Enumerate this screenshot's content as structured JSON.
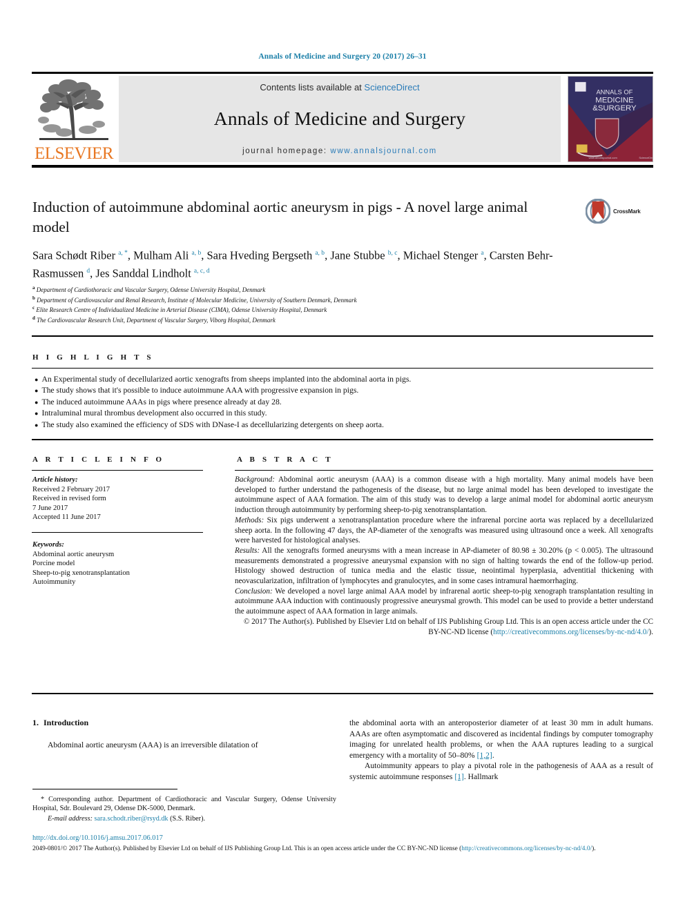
{
  "running_head": "Annals of Medicine and Surgery 20 (2017) 26–31",
  "masthead": {
    "publisher_name": "ELSEVIER",
    "contents_prefix": "Contents lists available at ",
    "contents_link": "ScienceDirect",
    "journal_name": "Annals of Medicine and Surgery",
    "homepage_prefix": "journal homepage: ",
    "homepage_link": "www.annalsjournal.com",
    "cover_title_line1": "ANNALS OF",
    "cover_title_line2": "MEDICINE",
    "cover_title_line3": "&SURGERY"
  },
  "article": {
    "title": "Induction of autoimmune abdominal aortic aneurysm in pigs - A novel large animal model",
    "crossmark_label": "CrossMark",
    "authors_html": "Sara Schødt Riber <sup>a, *</sup>, Mulham Ali <sup>a, b</sup>, Sara Hveding Bergseth <sup>a, b</sup>, Jane Stubbe <sup>b, c</sup>, Michael Stenger <sup>a</sup>, Carsten Behr-Rasmussen <sup>d</sup>, Jes Sanddal Lindholt <sup>a, c, d</sup>",
    "affiliations": [
      {
        "mark": "a",
        "text": "Department of Cardiothoracic and Vascular Surgery, Odense University Hospital, Denmark"
      },
      {
        "mark": "b",
        "text": "Department of Cardiovascular and Renal Research, Institute of Molecular Medicine, University of Southern Denmark, Denmark"
      },
      {
        "mark": "c",
        "text": "Elite Research Centre of Individualized Medicine in Arterial Disease (CIMA), Odense University Hospital, Denmark"
      },
      {
        "mark": "d",
        "text": "The Cardiovascular Research Unit, Department of Vascular Surgery, Viborg Hospital, Denmark"
      }
    ]
  },
  "highlights": {
    "heading": "H I G H L I G H T S",
    "bullet_glyph": "●",
    "items": [
      "An Experimental study of decellularized aortic xenografts from sheeps implanted into the abdominal aorta in pigs.",
      "The study shows that it's possible to induce autoimmune AAA with progressive expansion in pigs.",
      "The induced autoimmune AAAs in pigs where presence already at day 28.",
      "Intraluminal mural thrombus development also occurred in this study.",
      "The study also examined the efficiency of SDS with DNase-I as decellularizing detergents on sheep aorta."
    ]
  },
  "article_info": {
    "heading": "A R T I C L E  I N F O",
    "history_label": "Article history:",
    "history_lines": [
      "Received 2 February 2017",
      "Received in revised form",
      "7 June 2017",
      "Accepted 11 June 2017"
    ],
    "keywords_label": "Keywords:",
    "keywords": [
      "Abdominal aortic aneurysm",
      "Porcine model",
      "Sheep-to-pig xenotransplantation",
      "Autoimmunity"
    ]
  },
  "abstract": {
    "heading": "A B S T R A C T",
    "background_label": "Background:",
    "background_text": " Abdominal aortic aneurysm (AAA) is a common disease with a high mortality. Many animal models have been developed to further understand the pathogenesis of the disease, but no large animal model has been developed to investigate the autoimmune aspect of AAA formation. The aim of this study was to develop a large animal model for abdominal aortic aneurysm induction through autoimmunity by performing sheep-to-pig xenotransplantation.",
    "methods_label": "Methods:",
    "methods_text": " Six pigs underwent a xenotransplantation procedure where the infrarenal porcine aorta was replaced by a decellularized sheep aorta. In the following 47 days, the AP-diameter of the xenografts was measured using ultrasound once a week. All xenografts were harvested for histological analyses.",
    "results_label": "Results:",
    "results_text": " All the xenografts formed aneurysms with a mean increase in AP-diameter of 80.98 ± 30.20% (p < 0.005). The ultrasound measurements demonstrated a progressive aneurysmal expansion with no sign of halting towards the end of the follow-up period. Histology showed destruction of tunica media and the elastic tissue, neointimal hyperplasia, adventitial thickening with neovascularization, infiltration of lymphocytes and granulocytes, and in some cases intramural haemorrhaging.",
    "conclusion_label": "Conclusion:",
    "conclusion_text": " We developed a novel large animal AAA model by infrarenal aortic sheep-to-pig xenograph transplantation resulting in autoimmune AAA induction with continuously progressive aneurysmal growth. This model can be used to provide a better understand the autoimmune aspect of AAA formation in large animals.",
    "copyright_text": "© 2017 The Author(s). Published by Elsevier Ltd on behalf of IJS Publishing Group Ltd. This is an open access article under the CC BY-NC-ND license (",
    "copyright_link": "http://creativecommons.org/licenses/by-nc-nd/4.0/",
    "copyright_tail": ")."
  },
  "body": {
    "section_number": "1.",
    "section_title": "Introduction",
    "left_paragraph": "Abdominal aortic aneurysm (AAA) is an irreversible dilatation of",
    "right_paragraph_1a": "the abdominal aorta with an anteroposterior diameter of at least 30 mm in adult humans. AAAs are often asymptomatic and discovered as incidental findings by computer tomography imaging for unrelated health problems, or when the AAA ruptures leading to a surgical emergency with a mortality of 50–80% ",
    "right_ref_1": "[1,2]",
    "right_paragraph_1b": ".",
    "right_paragraph_2a": "Autoimmunity appears to play a pivotal role in the pathogenesis of AAA as a result of systemic autoimmune responses ",
    "right_ref_2": "[1]",
    "right_paragraph_2b": ". Hallmark"
  },
  "footnotes": {
    "corresponding_marker": "*",
    "corresponding_text": " Corresponding author. Department of Cardiothoracic and Vascular Surgery, Odense University Hospital, Sdr. Boulevard 29, Odense DK-5000, Denmark.",
    "email_label": "E-mail address:",
    "email": "sara.schodt.riber@rsyd.dk",
    "email_suffix": " (S.S. Riber).",
    "doi": "http://dx.doi.org/10.1016/j.amsu.2017.06.017",
    "issn_line": "2049-0801/© 2017 The Author(s). Published by Elsevier Ltd on behalf of IJS Publishing Group Ltd. This is an open access article under the CC BY-NC-ND license (",
    "issn_link": "http://creativecommons.org/licenses/by-nc-nd/4.0/",
    "issn_tail": ")."
  },
  "colors": {
    "link": "#1b7fa8",
    "elsevier_orange": "#e87722",
    "masthead_grey": "#e6e6e6"
  }
}
